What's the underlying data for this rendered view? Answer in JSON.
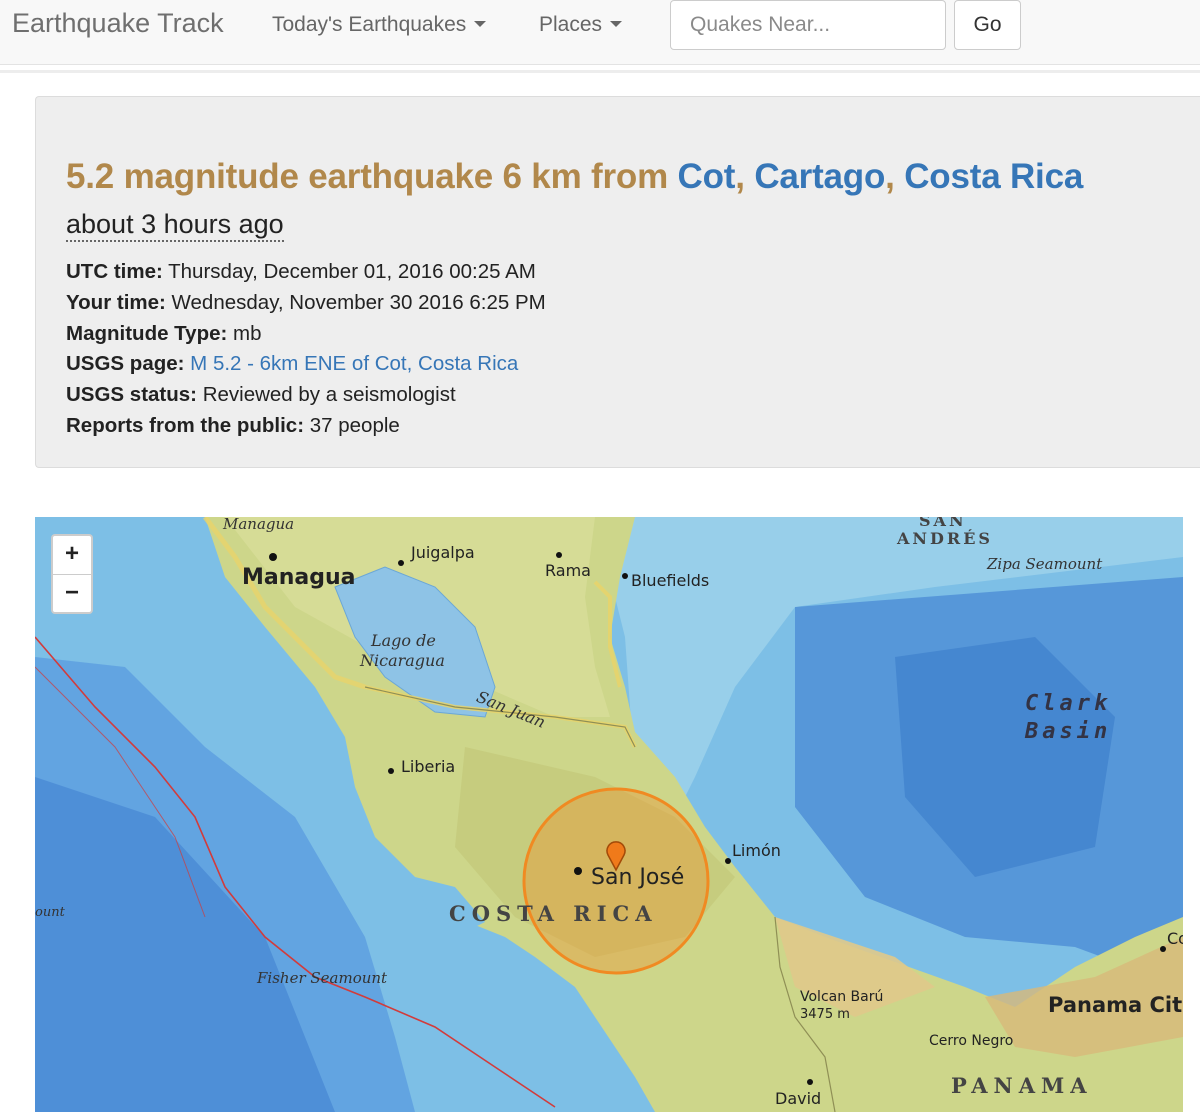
{
  "nav": {
    "brand": "Earthquake Track",
    "todays": "Today's Earthquakes",
    "places": "Places",
    "search_placeholder": "Quakes Near...",
    "go_label": "Go"
  },
  "quake": {
    "headline_prefix": "5.2 magnitude earthquake 6 km from ",
    "place": "Cot",
    "region": "Cartago",
    "country": "Costa Rica",
    "sep": ", ",
    "time_ago": "about 3 hours ago",
    "details": [
      {
        "label": "UTC time:",
        "value": " Thursday, December 01, 2016 00:25 AM"
      },
      {
        "label": "Your time:",
        "value": " Wednesday, November 30 2016 6:25 PM"
      },
      {
        "label": "Magnitude Type:",
        "value": " mb"
      },
      {
        "label": "USGS page:",
        "link": "M 5.2 - 6km ENE of Cot, Costa Rica"
      },
      {
        "label": "USGS status:",
        "value": " Reviewed by a seismologist"
      },
      {
        "label": "Reports from the public:",
        "value": " 37 people"
      }
    ]
  },
  "map": {
    "zoom_in": "+",
    "zoom_out": "−",
    "labels": {
      "managua_small": "Managua",
      "managua": "Managua",
      "juigalpa": "Juigalpa",
      "rama": "Rama",
      "bluefields": "Bluefields",
      "san": "SAN",
      "andres": "ANDRÉS",
      "zipa": "Zipa Seamount",
      "lago1": "Lago de",
      "lago2": "Nicaragua",
      "san_juan": "San Juan",
      "clark": "Clark",
      "basin": "Basin",
      "liberia": "Liberia",
      "limon": "Limón",
      "san_jose": "San José",
      "costa_rica": "COSTA RICA",
      "ount": "ount",
      "fisher": "Fisher Seamount",
      "co": "Co",
      "volcan": "Volcan Barú",
      "elev": "3475 m",
      "panama_city": "Panama Cit",
      "cerro": "Cerro Negro",
      "panama": "PANAMA",
      "david": "David"
    },
    "colors": {
      "ocean": "#7dbfe6",
      "land": "#cdd68a",
      "quake_ring": "#f08a22",
      "marker": "#f07a1a"
    }
  }
}
